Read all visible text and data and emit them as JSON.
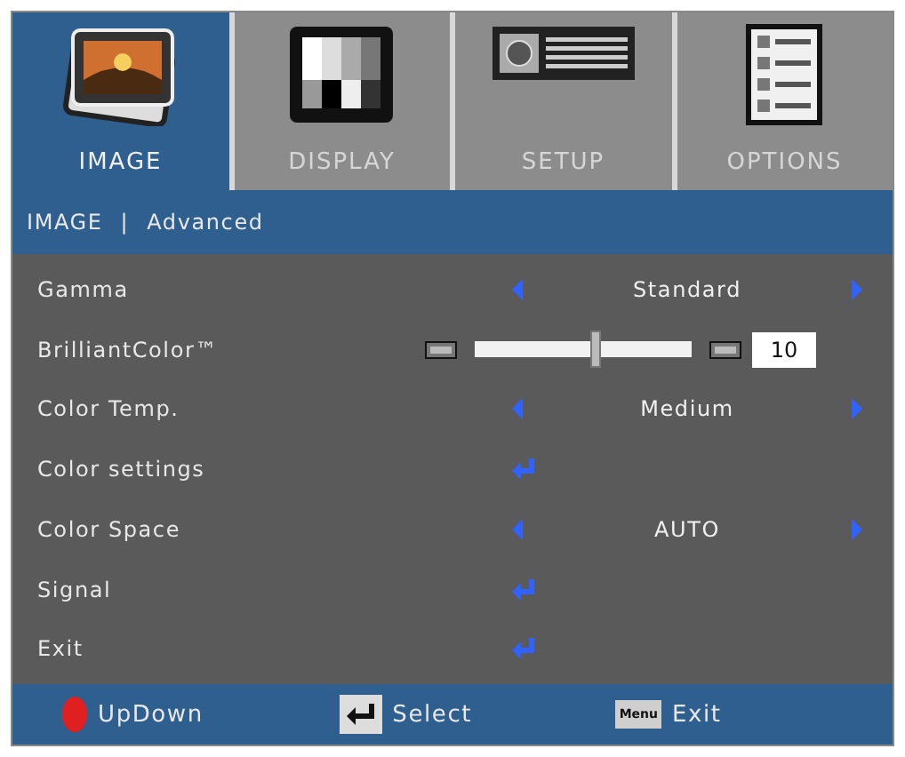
{
  "tabs": [
    {
      "label": "IMAGE",
      "selected": true,
      "kind": "image"
    },
    {
      "label": "DISPLAY",
      "selected": false,
      "kind": "display"
    },
    {
      "label": "SETUP",
      "selected": false,
      "kind": "setup"
    },
    {
      "label": "OPTIONS",
      "selected": false,
      "kind": "options"
    }
  ],
  "breadcrumb": {
    "section": "IMAGE",
    "separator": "|",
    "page": "Advanced"
  },
  "rows": [
    {
      "kind": "choice",
      "label": "Gamma",
      "value": "Standard"
    },
    {
      "kind": "slider",
      "label": "BrilliantColor™",
      "level": 0.55,
      "reading": "10"
    },
    {
      "kind": "choice",
      "label": "Color Temp.",
      "value": "Medium"
    },
    {
      "kind": "enter",
      "label": "Color settings"
    },
    {
      "kind": "choice",
      "label": "Color Space",
      "value": "AUTO"
    },
    {
      "kind": "enter",
      "label": "Signal"
    },
    {
      "kind": "enter",
      "label": "Exit"
    }
  ],
  "footer": [
    {
      "kind": "updown",
      "label": "UpDown"
    },
    {
      "kind": "enter",
      "label": "Select"
    },
    {
      "kind": "menu",
      "key": "Menu",
      "label": "Exit"
    }
  ]
}
